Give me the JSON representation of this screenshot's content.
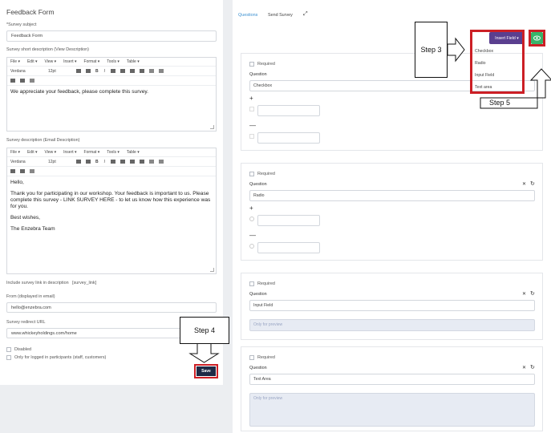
{
  "form": {
    "title": "Feedback Form",
    "survey_subject_label": "*Survey subject",
    "survey_subject_value": "Feedback Form",
    "short_desc_label": "Survey short description (View Description)",
    "editor_menu": [
      "File ▾",
      "Edit ▾",
      "View ▾",
      "Insert ▾",
      "Format ▾",
      "Tools ▾",
      "Table ▾"
    ],
    "font_name": "Verdana",
    "font_size": "12pt",
    "short_desc_text": "We appreciate your feedback, please complete this survey.",
    "email_desc_label": "Survey description (Email Description)",
    "email_desc_lines": [
      "Hello,",
      "Thank you for participating in our workshop. Your feedback is important to us. Please complete this survey - LINK SURVEY HERE - to let us know how this experience was for you.",
      "Best wishes,",
      "The Enzebra Team"
    ],
    "include_link_label": "Include survey link in description",
    "include_link_token": "[survey_link]",
    "from_label": "From (displayed in email)",
    "from_value": "hello@enzebra.com",
    "redirect_label": "Survey redirect URL",
    "redirect_value": "www.whickeyholdings.com/home",
    "disabled_label": "Disabled",
    "logged_in_label": "Only for logged in participants (staff, customers)",
    "save_label": "Save"
  },
  "builder": {
    "tab_questions": "Questions",
    "tab_send": "Send Survey",
    "insert_field_label": "Insert Field ▾",
    "insert_options": [
      "Checkbox",
      "Radio",
      "Input Field",
      "Text area"
    ],
    "required_label": "Required",
    "question_label": "Question",
    "preview_placeholder": "Only for preview",
    "cards": [
      {
        "type": "Checkbox"
      },
      {
        "type": "Radio"
      },
      {
        "type": "Input Field"
      },
      {
        "type": "Text Area"
      }
    ],
    "plus": "+",
    "minus": "—",
    "close": "✕",
    "refresh": "↻"
  },
  "callouts": {
    "step3": "Step 3",
    "step4": "Step 4",
    "step5": "Step 5"
  },
  "colors": {
    "save_button": "#1e2a46",
    "insert_button": "#5a3f8f",
    "preview_button": "#38b46a",
    "highlight": "#cc1f25"
  }
}
